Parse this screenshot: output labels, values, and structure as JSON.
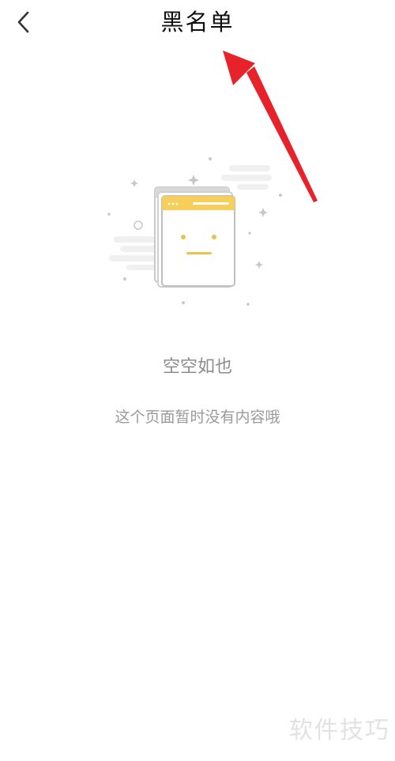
{
  "header": {
    "title": "黑名单"
  },
  "empty_state": {
    "title": "空空如也",
    "description": "这个页面暂时没有内容哦"
  },
  "watermark": {
    "text": "软件技巧"
  },
  "colors": {
    "arrow": "#e8222a",
    "card_header": "#f5cf5a",
    "face": "#e8c34a",
    "muted_text": "#8c8c8c"
  },
  "icons": {
    "back": "chevron-left-icon",
    "empty": "empty-page-illustration"
  }
}
